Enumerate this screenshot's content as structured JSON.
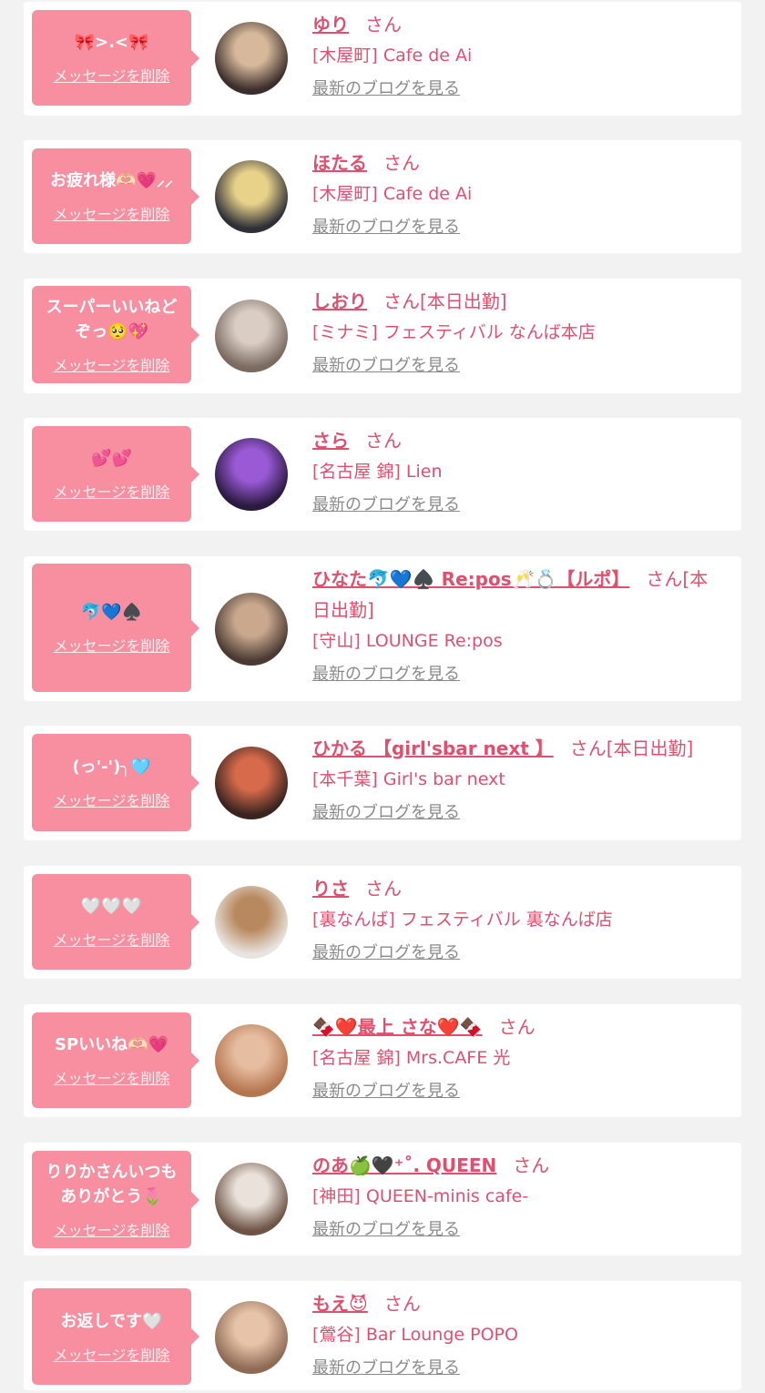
{
  "delete_label": "メッセージを削除",
  "blog_label": "最新のブログを見る",
  "san_label": "さん",
  "cards": [
    {
      "message": "🎀>.<🎀",
      "name": "ゆり",
      "san": "さん",
      "shop": "[木屋町] Cafe de Ai",
      "avatar_colors": [
        "#d7b89a",
        "#3b2e2c"
      ]
    },
    {
      "message": "お疲れ様🫶🏻💗⸝⸝",
      "name": "ほたる",
      "san": "さん",
      "shop": "[木屋町] Cafe de Ai",
      "avatar_colors": [
        "#e8d28a",
        "#2f2f38"
      ]
    },
    {
      "message": "スーパーいいねど\nぞっ🥺💖",
      "name": "しおり",
      "san": "さん[本日出勤]",
      "shop": "[ミナミ] フェスティバル なんば本店",
      "avatar_colors": [
        "#d9cdc4",
        "#7a6a60"
      ]
    },
    {
      "message": "💕💕",
      "name": "さら",
      "san": "さん",
      "shop": "[名古屋 錦] Lien",
      "avatar_colors": [
        "#9a5ad6",
        "#2b1a40"
      ]
    },
    {
      "message": "🐬💙♠️",
      "name": "ひなた🐬💙♠️ Re:pos🥂💍【ルポ】",
      "san": "さん[本日出勤]",
      "shop": "[守山] LOUNGE Re:pos",
      "avatar_colors": [
        "#c9a88e",
        "#4a3a33"
      ]
    },
    {
      "message": "(っ'-')╮🩵",
      "name": "ひかる 【girl'sbar next 】",
      "san": "さん[本日出勤]",
      "shop": "[本千葉] Girl's bar next",
      "avatar_colors": [
        "#d66a4a",
        "#3a2420"
      ]
    },
    {
      "message": "🤍🤍🤍",
      "name": "りさ",
      "san": "さん",
      "shop": "[裏なんば] フェスティバル 裏なんば店",
      "avatar_colors": [
        "#b8895e",
        "#e8e4e0"
      ]
    },
    {
      "message": "SPいいね🫶🏻💗",
      "name": "🍫❤️最上 さな❤️🍫",
      "san": "さん",
      "shop": "[名古屋 錦] Mrs.CAFE 光",
      "avatar_colors": [
        "#e6bda0",
        "#b5754f"
      ]
    },
    {
      "message": "りりかさんいつも\nありがとう🌷",
      "name": "のあ🍏🖤⁺˚. QUEEN",
      "san": "さん",
      "shop": "[神田] QUEEN-minis cafe-",
      "avatar_colors": [
        "#e9e1da",
        "#6e5446"
      ]
    },
    {
      "message": "お返しです🤍",
      "name": "もえ😈",
      "san": "さん",
      "shop": "[鶯谷] Bar Lounge POPO",
      "avatar_colors": [
        "#e6c4a8",
        "#8f6a55"
      ]
    }
  ]
}
